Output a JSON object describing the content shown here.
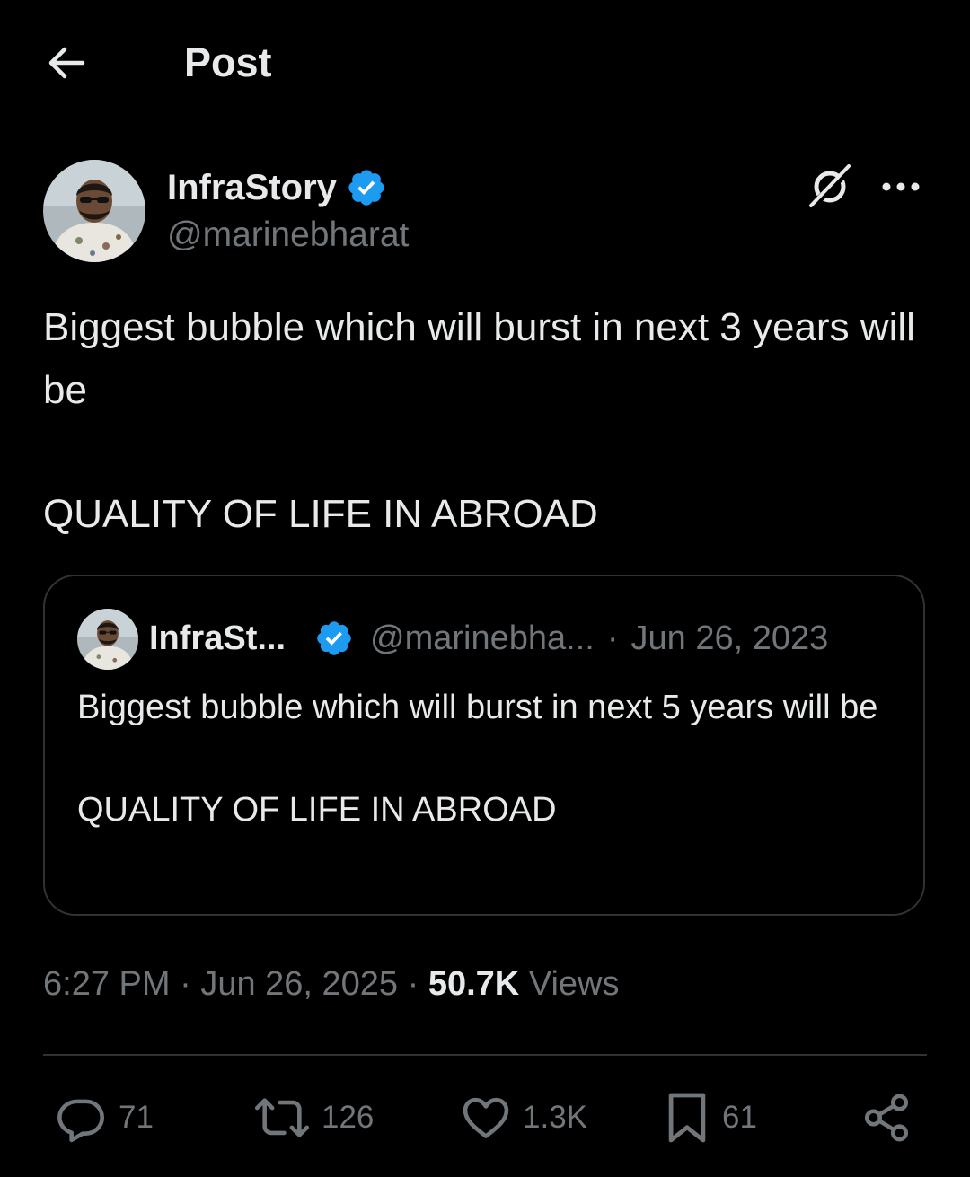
{
  "colors": {
    "background": "#000000",
    "primary_text": "#e7e9ea",
    "secondary_text": "#71767b",
    "border": "#2f3336",
    "verified": "#1d9bf0"
  },
  "header": {
    "title": "Post",
    "back_icon": "arrow-left-icon"
  },
  "post": {
    "author": {
      "name": "InfraStory",
      "handle": "@marinebharat",
      "verified": true
    },
    "text_line1": "Biggest bubble which will burst in next 3 years will be",
    "text_line2": "QUALITY OF LIFE IN ABROAD",
    "quote": {
      "name": "InfraSt...",
      "handle": "@marinebha...",
      "separator": "·",
      "date": "Jun 26, 2023",
      "text_line1": "Biggest bubble which will burst in next 5 years will be",
      "text_line2": "QUALITY OF LIFE IN ABROAD"
    },
    "time": "6:27 PM",
    "date": "Jun 26, 2025",
    "separator": "·",
    "views_count": "50.7K",
    "views_label": "Views"
  },
  "actions": {
    "replies": "71",
    "reposts": "126",
    "likes": "1.3K",
    "bookmarks": "61"
  }
}
